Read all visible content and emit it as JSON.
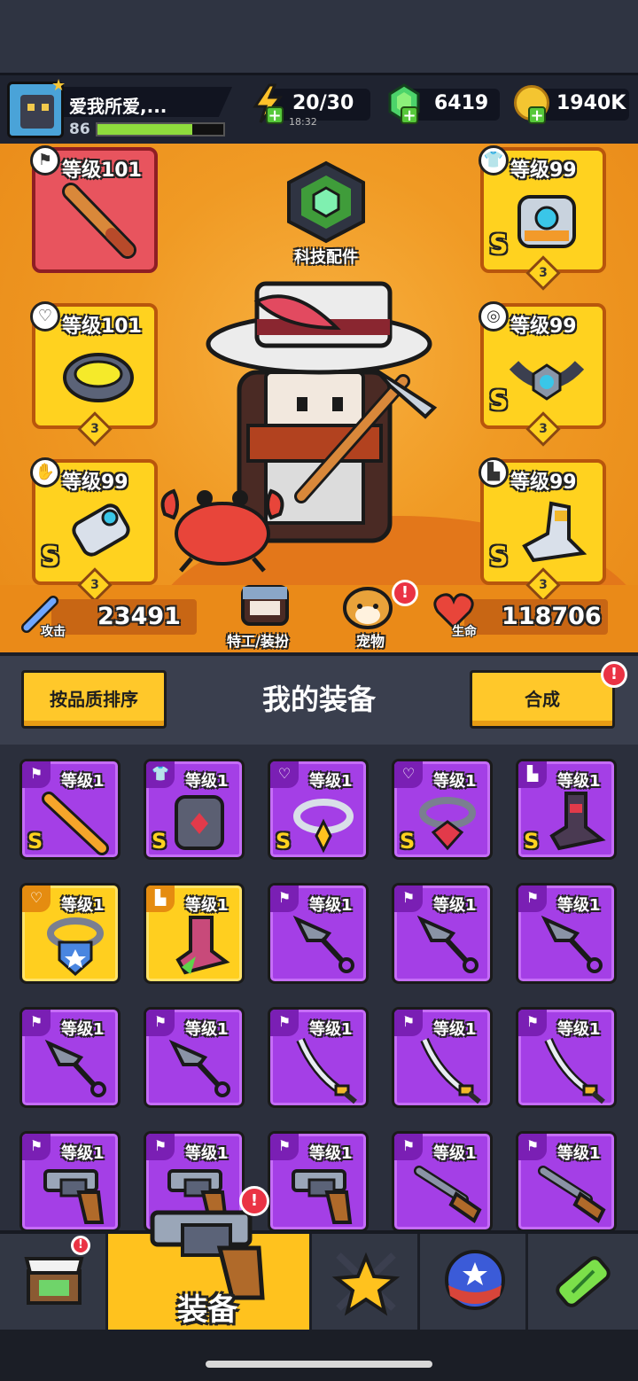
{
  "player": {
    "name": "爱我所爱,...",
    "level": "86",
    "xp_fraction": 0.75
  },
  "resources": {
    "energy": "20/30",
    "energy_timer": "18:32",
    "gems": "6419",
    "coins": "1940K"
  },
  "equipped": {
    "weapon_level": "等级101",
    "armor_level": "等级99",
    "necklace_level": "等级101",
    "belt_level": "等级99",
    "gloves_level": "等级99",
    "boots_level": "等级99",
    "grade": "S",
    "stars": "3"
  },
  "tech_parts": "科技配件",
  "stats": {
    "attack_label": "攻击",
    "attack_value": "23491",
    "hp_label": "生命",
    "hp_value": "118706"
  },
  "agent_label": "特工/装扮",
  "pet_label": "宠物",
  "badge": "!",
  "inventory": {
    "sort_button": "按品质排序",
    "title": "我的装备",
    "merge_button": "合成",
    "level_label": "等级1",
    "grade": "S",
    "items": [
      {
        "kind": "sword",
        "rarity": "purple",
        "grade": true
      },
      {
        "kind": "armor",
        "rarity": "purple",
        "grade": true
      },
      {
        "kind": "necklace",
        "rarity": "purple",
        "grade": true
      },
      {
        "kind": "chain",
        "rarity": "purple",
        "grade": true
      },
      {
        "kind": "boots",
        "rarity": "purple",
        "grade": true
      },
      {
        "kind": "necklace-shield",
        "rarity": "gold",
        "grade": false
      },
      {
        "kind": "boots-green",
        "rarity": "gold",
        "grade": false
      },
      {
        "kind": "kunai",
        "rarity": "purple",
        "grade": false
      },
      {
        "kind": "kunai",
        "rarity": "purple",
        "grade": false
      },
      {
        "kind": "kunai",
        "rarity": "purple",
        "grade": false
      },
      {
        "kind": "kunai",
        "rarity": "purple",
        "grade": false
      },
      {
        "kind": "kunai",
        "rarity": "purple",
        "grade": false
      },
      {
        "kind": "katana",
        "rarity": "purple",
        "grade": false
      },
      {
        "kind": "katana",
        "rarity": "purple",
        "grade": false
      },
      {
        "kind": "katana",
        "rarity": "purple",
        "grade": false
      },
      {
        "kind": "revolver",
        "rarity": "purple",
        "grade": false
      },
      {
        "kind": "revolver",
        "rarity": "purple",
        "grade": false
      },
      {
        "kind": "revolver",
        "rarity": "purple",
        "grade": false
      },
      {
        "kind": "shotgun",
        "rarity": "purple",
        "grade": false
      },
      {
        "kind": "shotgun",
        "rarity": "purple",
        "grade": false
      }
    ]
  },
  "nav": {
    "shop_icon": "shop-icon",
    "equipment_label": "装备",
    "talent_icon": "star-swords-icon",
    "ball_icon": "star-ball-icon",
    "gene_icon": "gene-capsule-icon"
  },
  "colors": {
    "stage_orange": "#f0901e",
    "purple_item": "#a43fe6",
    "gold_item": "#ffcf1f",
    "accent_yellow": "#ffc82a"
  }
}
